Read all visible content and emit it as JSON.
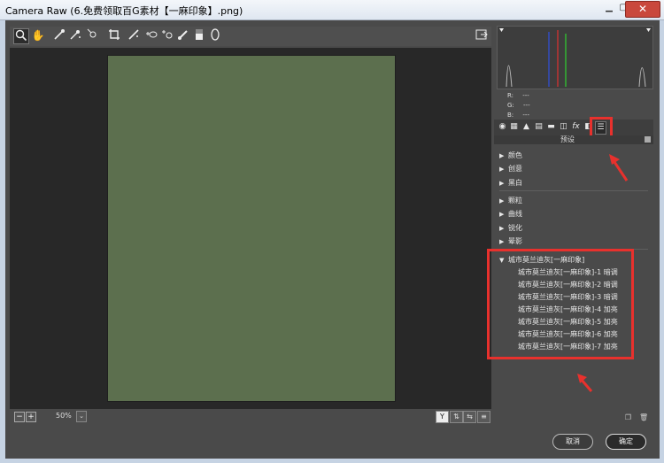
{
  "window": {
    "title": "Camera Raw (6.免费领取百G素材【一麻印象】.png)",
    "minimize_icon": "minimize-icon",
    "maximize_icon": "maximize-icon",
    "close_label": "✕"
  },
  "toolbar": {
    "tools": [
      "zoom-icon",
      "hand-icon",
      "white-balance-icon",
      "color-sampler-icon",
      "targeted-adjustment-icon",
      "crop-icon",
      "straighten-icon",
      "spot-removal-icon",
      "red-eye-icon",
      "adjustment-brush-icon",
      "graduated-filter-icon",
      "radial-filter-icon"
    ],
    "open_preferences_icon": "open-in-preferences-icon"
  },
  "status": {
    "zoom_out_label": "−",
    "zoom_in_label": "+",
    "zoom_level": "50%",
    "view_y_label": "Y"
  },
  "histogram": {
    "colors": {
      "red": "#e03030",
      "green": "#30d030",
      "blue": "#3050e0"
    }
  },
  "rgb_readout": [
    {
      "channel": "R:",
      "value": "---"
    },
    {
      "channel": "G:",
      "value": "---"
    },
    {
      "channel": "B:",
      "value": "---"
    }
  ],
  "panel_tabs": [
    "basic-icon",
    "tone-curve-icon",
    "detail-icon",
    "hsl-icon",
    "split-toning-icon",
    "lens-corrections-icon",
    "effects-icon",
    "camera-calibration-icon",
    "presets-icon"
  ],
  "presets_panel": {
    "title": "预设",
    "groups": [
      {
        "label": "颜色",
        "expanded": false
      },
      {
        "label": "创意",
        "expanded": false
      },
      {
        "label": "黑白",
        "expanded": false
      },
      {
        "label": "颗粒",
        "expanded": false
      },
      {
        "label": "曲线",
        "expanded": false
      },
      {
        "label": "锐化",
        "expanded": false
      },
      {
        "label": "晕影",
        "expanded": false
      },
      {
        "label": "城市莫兰迪灰[一麻印象]",
        "expanded": true
      }
    ],
    "items": [
      "城市莫兰迪灰[一麻印象]-1 暗调",
      "城市莫兰迪灰[一麻印象]-2 暗调",
      "城市莫兰迪灰[一麻印象]-3 暗调",
      "城市莫兰迪灰[一麻印象]-4 加亮",
      "城市莫兰迪灰[一麻印象]-5 加亮",
      "城市莫兰迪灰[一麻印象]-6 加亮",
      "城市莫兰迪灰[一麻印象]-7 加亮"
    ]
  },
  "footer": {
    "cancel_label": "取消",
    "ok_label": "确定"
  },
  "colors": {
    "photo": "#5c6f4e",
    "highlight": "#e8312d"
  }
}
